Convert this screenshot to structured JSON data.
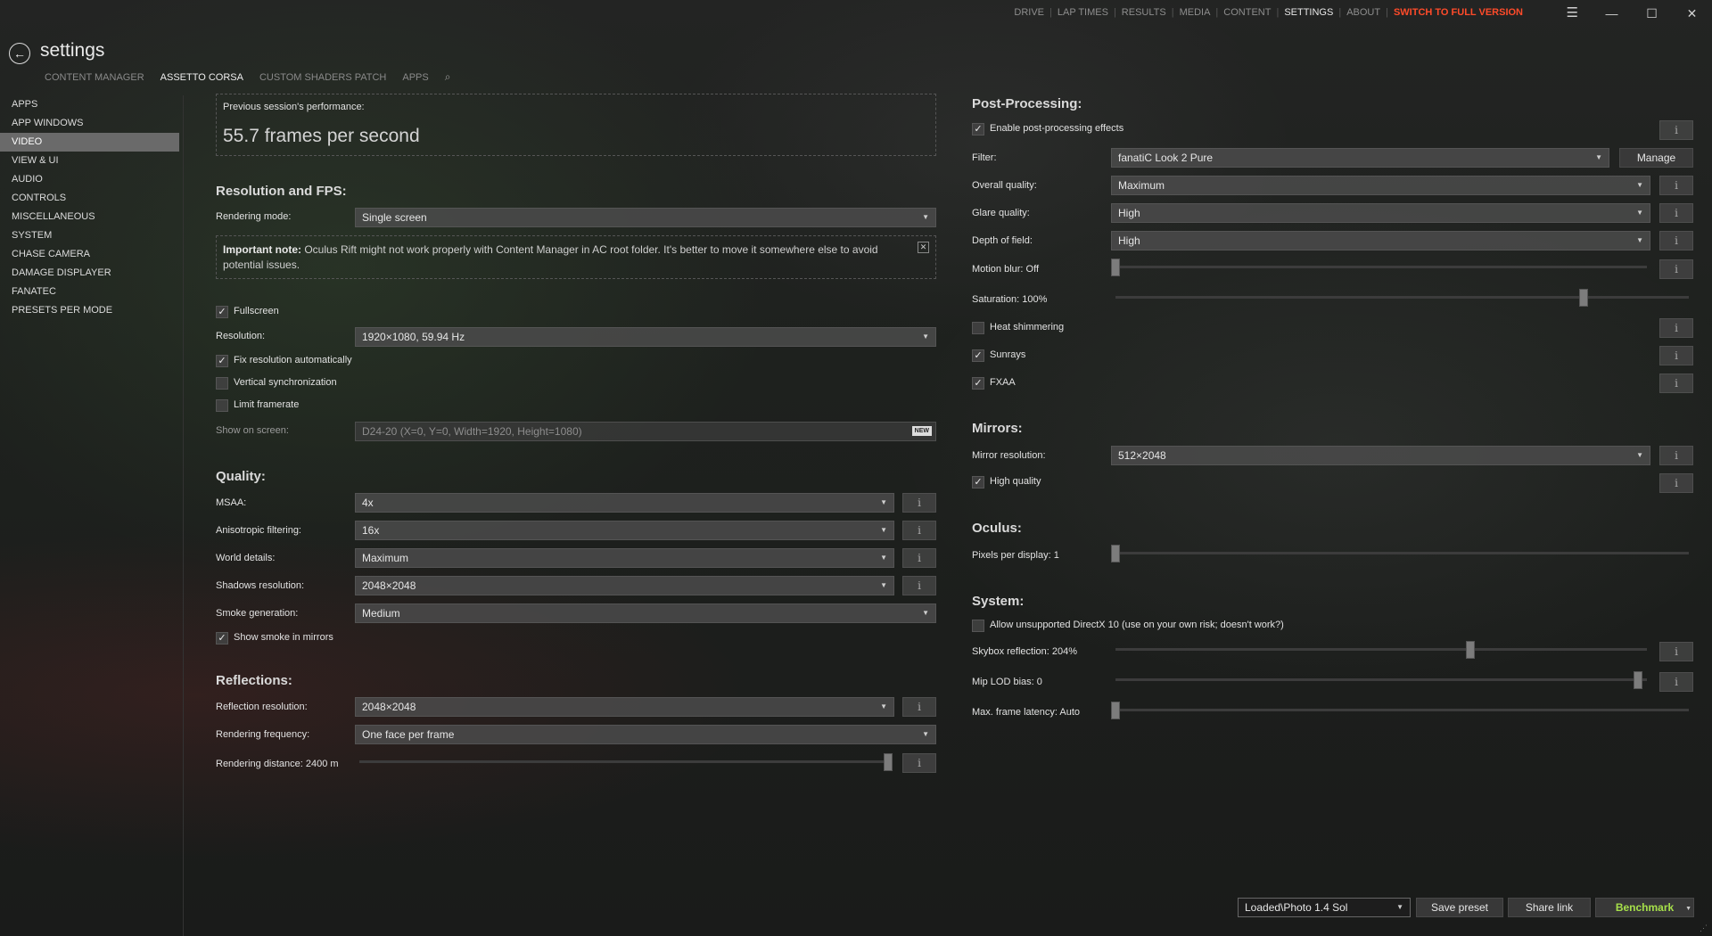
{
  "topnav": {
    "items": [
      "DRIVE",
      "LAP TIMES",
      "RESULTS",
      "MEDIA",
      "CONTENT",
      "SETTINGS",
      "ABOUT",
      "SWITCH TO FULL VERSION"
    ]
  },
  "header": {
    "title": "settings",
    "tabs": [
      "CONTENT MANAGER",
      "ASSETTO CORSA",
      "CUSTOM SHADERS PATCH",
      "APPS"
    ]
  },
  "sidebar": {
    "items": [
      "APPS",
      "APP WINDOWS",
      "VIDEO",
      "VIEW & UI",
      "AUDIO",
      "CONTROLS",
      "MISCELLANEOUS",
      "SYSTEM",
      "CHASE CAMERA",
      "DAMAGE DISPLAYER",
      "FANATEC",
      "PRESETS PER MODE"
    ],
    "active": "VIDEO"
  },
  "left": {
    "perf_label": "Previous session's performance:",
    "perf_value": "55.7 frames per second",
    "resfps_header": "Resolution and FPS:",
    "rendering_mode_label": "Rendering mode:",
    "rendering_mode_value": "Single screen",
    "note_bold": "Important note:",
    "note_text": " Oculus Rift might not work properly with Content Manager in AC root folder. It's better to move it somewhere else to avoid potential issues.",
    "fullscreen_label": "Fullscreen",
    "resolution_label": "Resolution:",
    "resolution_value": "1920×1080, 59.94 Hz",
    "fix_res_label": "Fix resolution automatically",
    "vsync_label": "Vertical synchronization",
    "limit_fps_label": "Limit framerate",
    "show_on_screen_label": "Show on screen:",
    "show_on_screen_value": "D24-20 (X=0, Y=0, Width=1920, Height=1080)",
    "new_badge": "NEW",
    "quality_header": "Quality:",
    "msaa_label": "MSAA:",
    "msaa_value": "4x",
    "aniso_label": "Anisotropic filtering:",
    "aniso_value": "16x",
    "world_label": "World details:",
    "world_value": "Maximum",
    "shadows_label": "Shadows resolution:",
    "shadows_value": "2048×2048",
    "smoke_label": "Smoke generation:",
    "smoke_value": "Medium",
    "smoke_mirrors_label": "Show smoke in mirrors",
    "reflections_header": "Reflections:",
    "refl_res_label": "Reflection resolution:",
    "refl_res_value": "2048×2048",
    "refl_freq_label": "Rendering frequency:",
    "refl_freq_value": "One face per frame",
    "refl_dist_label": "Rendering distance: 2400 m",
    "refl_dist_level": 1.0
  },
  "right": {
    "pp_header": "Post-Processing:",
    "pp_enable_label": "Enable post-processing effects",
    "filter_label": "Filter:",
    "filter_value": "fanatiC Look 2 Pure",
    "manage_label": "Manage",
    "overall_label": "Overall quality:",
    "overall_value": "Maximum",
    "glare_label": "Glare quality:",
    "glare_value": "High",
    "dof_label": "Depth of field:",
    "dof_value": "High",
    "motion_label": "Motion blur: Off",
    "motion_level": 0.0,
    "saturation_label": "Saturation: 100%",
    "saturation_level": 0.83,
    "heat_label": "Heat shimmering",
    "sunrays_label": "Sunrays",
    "fxaa_label": "FXAA",
    "mirrors_header": "Mirrors:",
    "mirror_res_label": "Mirror resolution:",
    "mirror_res_value": "512×2048",
    "high_quality_label": "High quality",
    "oculus_header": "Oculus:",
    "ppd_label": "Pixels per display: 1",
    "ppd_level": 0.0,
    "system_header": "System:",
    "dx10_label": "Allow unsupported DirectX 10 (use on your own risk; doesn't work?)",
    "skybox_label": "Skybox reflection: 204%",
    "skybox_level": 0.68,
    "mip_label": "Mip LOD bias: 0",
    "mip_level": 1.0,
    "latency_label": "Max. frame latency: Auto",
    "latency_level": 0.0
  },
  "footer": {
    "preset_value": "Loaded\\Photo 1.4 Sol",
    "save_preset": "Save preset",
    "share_link": "Share link",
    "benchmark": "Benchmark"
  },
  "colors": {
    "accent_full_version": "#ff4b2a",
    "benchmark": "#a6e04a"
  }
}
